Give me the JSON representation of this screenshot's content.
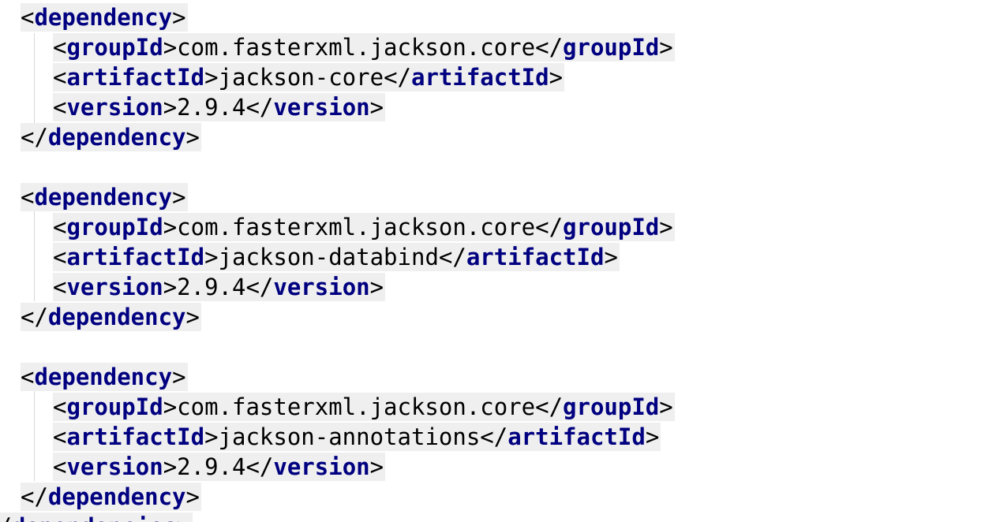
{
  "editor": {
    "lines": [
      {
        "indent": 1,
        "tokens": [
          {
            "k": "b",
            "t": "<"
          },
          {
            "k": "g",
            "t": "dependency"
          },
          {
            "k": "b",
            "t": ">"
          }
        ]
      },
      {
        "indent": 2,
        "tokens": [
          {
            "k": "b",
            "t": "<"
          },
          {
            "k": "g",
            "t": "groupId"
          },
          {
            "k": "b",
            "t": ">"
          },
          {
            "k": "x",
            "t": "com.fasterxml.jackson.core"
          },
          {
            "k": "b",
            "t": "</"
          },
          {
            "k": "g",
            "t": "groupId"
          },
          {
            "k": "b",
            "t": ">"
          }
        ]
      },
      {
        "indent": 2,
        "tokens": [
          {
            "k": "b",
            "t": "<"
          },
          {
            "k": "g",
            "t": "artifactId"
          },
          {
            "k": "b",
            "t": ">"
          },
          {
            "k": "x",
            "t": "jackson-core"
          },
          {
            "k": "b",
            "t": "</"
          },
          {
            "k": "g",
            "t": "artifactId"
          },
          {
            "k": "b",
            "t": ">"
          }
        ]
      },
      {
        "indent": 2,
        "tokens": [
          {
            "k": "b",
            "t": "<"
          },
          {
            "k": "g",
            "t": "version"
          },
          {
            "k": "b",
            "t": ">"
          },
          {
            "k": "x",
            "t": "2.9.4"
          },
          {
            "k": "b",
            "t": "</"
          },
          {
            "k": "g",
            "t": "version"
          },
          {
            "k": "b",
            "t": ">"
          }
        ]
      },
      {
        "indent": 1,
        "tokens": [
          {
            "k": "b",
            "t": "</"
          },
          {
            "k": "g",
            "t": "dependency"
          },
          {
            "k": "b",
            "t": ">"
          }
        ]
      },
      {
        "indent": 0,
        "tokens": []
      },
      {
        "indent": 1,
        "tokens": [
          {
            "k": "b",
            "t": "<"
          },
          {
            "k": "g",
            "t": "dependency"
          },
          {
            "k": "b",
            "t": ">"
          }
        ]
      },
      {
        "indent": 2,
        "tokens": [
          {
            "k": "b",
            "t": "<"
          },
          {
            "k": "g",
            "t": "groupId"
          },
          {
            "k": "b",
            "t": ">"
          },
          {
            "k": "x",
            "t": "com.fasterxml.jackson.core"
          },
          {
            "k": "b",
            "t": "</"
          },
          {
            "k": "g",
            "t": "groupId"
          },
          {
            "k": "b",
            "t": ">"
          }
        ]
      },
      {
        "indent": 2,
        "tokens": [
          {
            "k": "b",
            "t": "<"
          },
          {
            "k": "g",
            "t": "artifactId"
          },
          {
            "k": "b",
            "t": ">"
          },
          {
            "k": "x",
            "t": "jackson-databind"
          },
          {
            "k": "b",
            "t": "</"
          },
          {
            "k": "g",
            "t": "artifactId"
          },
          {
            "k": "b",
            "t": ">"
          }
        ]
      },
      {
        "indent": 2,
        "tokens": [
          {
            "k": "b",
            "t": "<"
          },
          {
            "k": "g",
            "t": "version"
          },
          {
            "k": "b",
            "t": ">"
          },
          {
            "k": "x",
            "t": "2.9.4"
          },
          {
            "k": "b",
            "t": "</"
          },
          {
            "k": "g",
            "t": "version"
          },
          {
            "k": "b",
            "t": ">"
          }
        ]
      },
      {
        "indent": 1,
        "tokens": [
          {
            "k": "b",
            "t": "</"
          },
          {
            "k": "g",
            "t": "dependency"
          },
          {
            "k": "b",
            "t": ">"
          }
        ]
      },
      {
        "indent": 0,
        "tokens": []
      },
      {
        "indent": 1,
        "tokens": [
          {
            "k": "b",
            "t": "<"
          },
          {
            "k": "g",
            "t": "dependency"
          },
          {
            "k": "b",
            "t": ">"
          }
        ]
      },
      {
        "indent": 2,
        "tokens": [
          {
            "k": "b",
            "t": "<"
          },
          {
            "k": "g",
            "t": "groupId"
          },
          {
            "k": "b",
            "t": ">"
          },
          {
            "k": "x",
            "t": "com.fasterxml.jackson.core"
          },
          {
            "k": "b",
            "t": "</"
          },
          {
            "k": "g",
            "t": "groupId"
          },
          {
            "k": "b",
            "t": ">"
          }
        ]
      },
      {
        "indent": 2,
        "tokens": [
          {
            "k": "b",
            "t": "<"
          },
          {
            "k": "g",
            "t": "artifactId"
          },
          {
            "k": "b",
            "t": ">"
          },
          {
            "k": "x",
            "t": "jackson-annotations"
          },
          {
            "k": "b",
            "t": "</"
          },
          {
            "k": "g",
            "t": "artifactId"
          },
          {
            "k": "b",
            "t": ">"
          }
        ]
      },
      {
        "indent": 2,
        "tokens": [
          {
            "k": "b",
            "t": "<"
          },
          {
            "k": "g",
            "t": "version"
          },
          {
            "k": "b",
            "t": ">"
          },
          {
            "k": "x",
            "t": "2.9.4"
          },
          {
            "k": "b",
            "t": "</"
          },
          {
            "k": "g",
            "t": "version"
          },
          {
            "k": "b",
            "t": ">"
          }
        ]
      },
      {
        "indent": 1,
        "tokens": [
          {
            "k": "b",
            "t": "</"
          },
          {
            "k": "g",
            "t": "dependency"
          },
          {
            "k": "b",
            "t": ">"
          }
        ]
      },
      {
        "indent": 0,
        "tokens": [
          {
            "k": "b",
            "t": "</"
          },
          {
            "k": "g",
            "t": "dependencies"
          },
          {
            "k": "b",
            "t": ">"
          }
        ]
      }
    ]
  },
  "colors": {
    "tag_name": "#000080",
    "bracket": "#000000",
    "text": "#000000",
    "line_highlight": "#efefef",
    "indent_guide": "#d8d8d8"
  }
}
